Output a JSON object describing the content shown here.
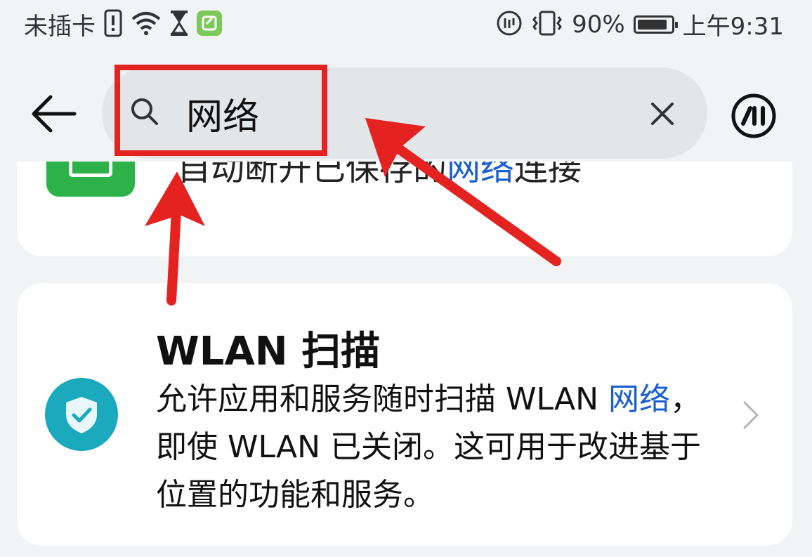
{
  "status_bar": {
    "carrier": "未插卡",
    "battery_percent_text": "90%",
    "battery_level": 0.9,
    "time": "上午9:31",
    "icons": [
      "alert-icon",
      "wifi-icon",
      "hourglass-icon",
      "app-notification-icon",
      "data-saver-icon",
      "vibrate-icon",
      "battery-icon"
    ]
  },
  "search": {
    "query": "网络",
    "placeholder": ""
  },
  "results": {
    "partial_card": {
      "before": "自动断开已保存的",
      "highlight": "网络",
      "after": "连接"
    },
    "wlan_card": {
      "title": "WLAN 扫描",
      "desc_before": "允许应用和服务随时扫描 WLAN ",
      "desc_highlight": "网络",
      "desc_after": "，即使 WLAN 已关闭。这可用于改进基于位置的功能和服务。"
    }
  },
  "colors": {
    "background": "#f1f3f5",
    "card": "#ffffff",
    "search_box": "#e3e6e9",
    "highlight_text": "#1a5fd0",
    "annotation_red": "#e42321",
    "shield_teal": "#1aa9bd",
    "app_green": "#2db24a"
  }
}
